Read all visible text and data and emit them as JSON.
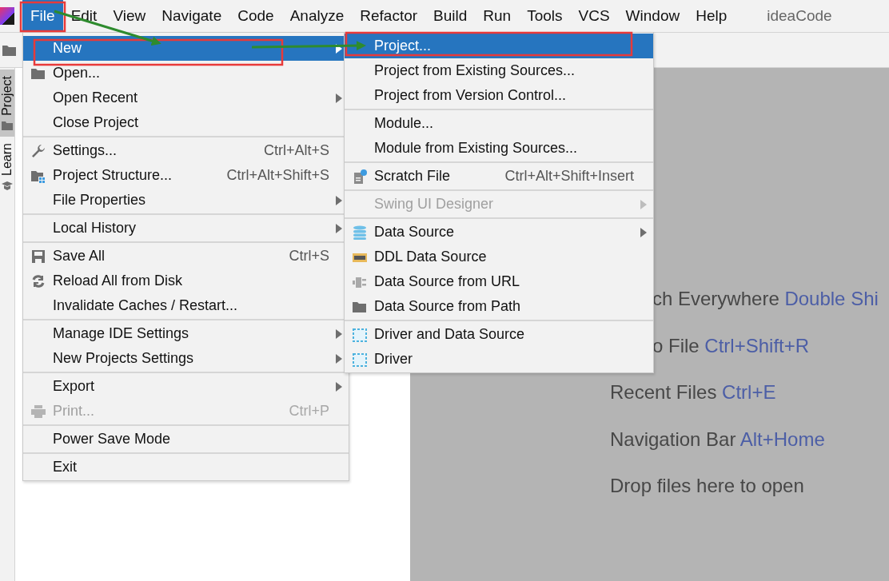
{
  "menu_bar": {
    "items": [
      {
        "label": "File",
        "selected": true
      },
      {
        "label": "Edit",
        "selected": false
      },
      {
        "label": "View",
        "selected": false
      },
      {
        "label": "Navigate",
        "selected": false
      },
      {
        "label": "Code",
        "selected": false
      },
      {
        "label": "Analyze",
        "selected": false
      },
      {
        "label": "Refactor",
        "selected": false
      },
      {
        "label": "Build",
        "selected": false
      },
      {
        "label": "Run",
        "selected": false
      },
      {
        "label": "Tools",
        "selected": false
      },
      {
        "label": "VCS",
        "selected": false
      },
      {
        "label": "Window",
        "selected": false
      },
      {
        "label": "Help",
        "selected": false
      }
    ],
    "project_name": "ideaCode"
  },
  "tool_strip": {
    "tabs": [
      {
        "label": "Project",
        "selected": true
      },
      {
        "label": "Learn",
        "selected": false
      }
    ]
  },
  "file_menu": {
    "groups": [
      [
        {
          "label": "New",
          "selected": true,
          "disabled": false,
          "submenu": true
        },
        {
          "label": "Open...",
          "selected": false,
          "disabled": false,
          "submenu": false
        },
        {
          "label": "Open Recent",
          "selected": false,
          "disabled": false,
          "submenu": true
        },
        {
          "label": "Close Project",
          "selected": false,
          "disabled": false,
          "submenu": false
        }
      ],
      [
        {
          "label": "Settings...",
          "shortcut": "Ctrl+Alt+S",
          "selected": false,
          "disabled": false,
          "submenu": false
        },
        {
          "label": "Project Structure...",
          "shortcut": "Ctrl+Alt+Shift+S",
          "selected": false,
          "disabled": false,
          "submenu": false
        },
        {
          "label": "File Properties",
          "selected": false,
          "disabled": false,
          "submenu": true
        }
      ],
      [
        {
          "label": "Local History",
          "selected": false,
          "disabled": false,
          "submenu": true
        }
      ],
      [
        {
          "label": "Save All",
          "shortcut": "Ctrl+S",
          "selected": false,
          "disabled": false,
          "submenu": false
        },
        {
          "label": "Reload All from Disk",
          "selected": false,
          "disabled": false,
          "submenu": false
        },
        {
          "label": "Invalidate Caches / Restart...",
          "selected": false,
          "disabled": false,
          "submenu": false
        }
      ],
      [
        {
          "label": "Manage IDE Settings",
          "selected": false,
          "disabled": false,
          "submenu": true
        },
        {
          "label": "New Projects Settings",
          "selected": false,
          "disabled": false,
          "submenu": true
        }
      ],
      [
        {
          "label": "Export",
          "selected": false,
          "disabled": false,
          "submenu": true
        },
        {
          "label": "Print...",
          "shortcut": "Ctrl+P",
          "selected": false,
          "disabled": true,
          "submenu": false
        }
      ],
      [
        {
          "label": "Power Save Mode",
          "selected": false,
          "disabled": false,
          "submenu": false
        }
      ],
      [
        {
          "label": "Exit",
          "selected": false,
          "disabled": false,
          "submenu": false
        }
      ]
    ]
  },
  "new_submenu": {
    "groups": [
      [
        {
          "label": "Project...",
          "selected": true,
          "disabled": false,
          "submenu": false
        },
        {
          "label": "Project from Existing Sources...",
          "selected": false,
          "disabled": false,
          "submenu": false
        },
        {
          "label": "Project from Version Control...",
          "selected": false,
          "disabled": false,
          "submenu": false
        }
      ],
      [
        {
          "label": "Module...",
          "selected": false,
          "disabled": false,
          "submenu": false
        },
        {
          "label": "Module from Existing Sources...",
          "selected": false,
          "disabled": false,
          "submenu": false
        }
      ],
      [
        {
          "label": "Scratch File",
          "shortcut": "Ctrl+Alt+Shift+Insert",
          "selected": false,
          "disabled": false,
          "submenu": false
        }
      ],
      [
        {
          "label": "Swing UI Designer",
          "selected": false,
          "disabled": true,
          "submenu": true
        }
      ],
      [
        {
          "label": "Data Source",
          "selected": false,
          "disabled": false,
          "submenu": true
        },
        {
          "label": "DDL Data Source",
          "selected": false,
          "disabled": false,
          "submenu": false
        },
        {
          "label": "Data Source from URL",
          "selected": false,
          "disabled": false,
          "submenu": false
        },
        {
          "label": "Data Source from Path",
          "selected": false,
          "disabled": false,
          "submenu": false
        }
      ],
      [
        {
          "label": "Driver and Data Source",
          "selected": false,
          "disabled": false,
          "submenu": false
        },
        {
          "label": "Driver",
          "selected": false,
          "disabled": false,
          "submenu": false
        }
      ]
    ]
  },
  "welcome_hints": [
    {
      "kind": "clipped",
      "action": "ch Everywhere",
      "shortcut": "Double Shi"
    },
    {
      "kind": "clipped",
      "action": "o File",
      "shortcut": "Ctrl+Shift+R"
    },
    {
      "kind": "full",
      "action": "Recent Files",
      "shortcut": "Ctrl+E"
    },
    {
      "kind": "full",
      "action": "Navigation Bar",
      "shortcut": "Alt+Home"
    },
    {
      "kind": "full",
      "action": "Drop files here to open"
    }
  ]
}
